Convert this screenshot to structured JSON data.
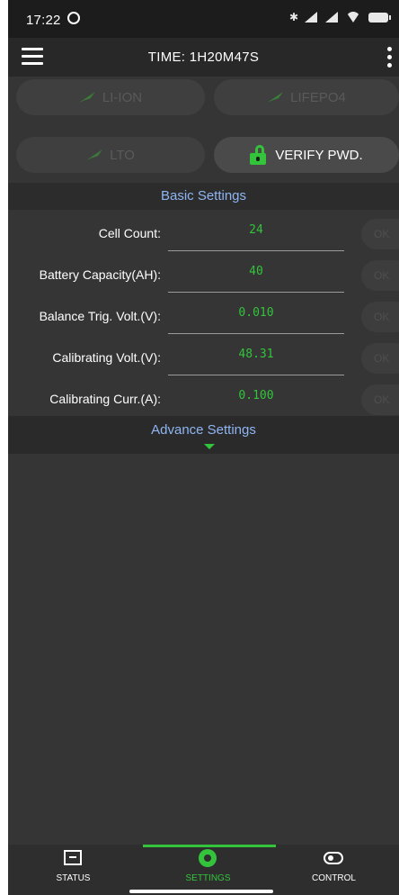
{
  "status_bar": {
    "time": "17:22"
  },
  "app_bar": {
    "title": "TIME: 1H20M47S"
  },
  "chemistry_buttons": {
    "li_ion": "LI-ION",
    "lifepo4": "LIFEPO4",
    "lto": "LTO",
    "verify": "VERIFY PWD."
  },
  "basic_settings": {
    "header": "Basic Settings",
    "rows": [
      {
        "label": "Cell Count:",
        "value": "24",
        "ok": "OK"
      },
      {
        "label": "Battery Capacity(AH):",
        "value": "40",
        "ok": "OK"
      },
      {
        "label": "Balance Trig. Volt.(V):",
        "value": "0.010",
        "ok": "OK"
      },
      {
        "label": "Calibrating Volt.(V):",
        "value": "48.31",
        "ok": "OK"
      },
      {
        "label": "Calibrating Curr.(A):",
        "value": "0.100",
        "ok": "OK"
      }
    ]
  },
  "advance_settings": {
    "label": "Advance Settings"
  },
  "bottom_nav": {
    "items": [
      {
        "label": "STATUS",
        "icon": "status-monitor-icon"
      },
      {
        "label": "SETTINGS",
        "icon": "gear-icon"
      },
      {
        "label": "CONTROL",
        "icon": "toggle-icon"
      }
    ],
    "active": "SETTINGS"
  },
  "colors": {
    "accent_green": "#33c43c",
    "section_blue": "#8fb5f2",
    "background": "#353535"
  }
}
